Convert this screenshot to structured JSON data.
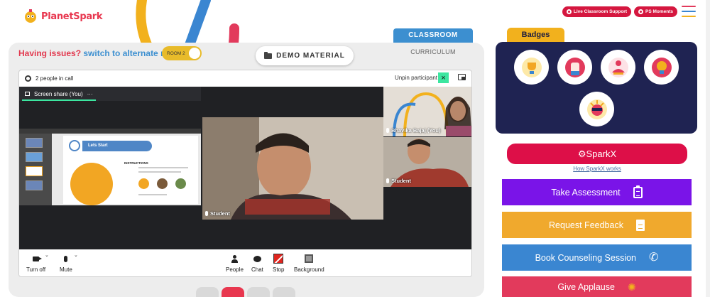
{
  "header": {
    "logo_text_a": "Planet",
    "logo_text_b": "Spark",
    "live_support": "Live Classroom Support",
    "ps_moments": "PS Moments"
  },
  "issues": {
    "question": "Having issues?",
    "switch": "switch to alternate room",
    "room_toggle": "ROOM 2"
  },
  "demo_material": "DEMO MATERIAL",
  "tabs": {
    "classroom": "CLASSROOM",
    "curriculum": "CURRICULUM"
  },
  "call": {
    "people_count": "2 people in call",
    "unpin": "Unpin participant",
    "screen_share_label": "Screen share (You)",
    "screen_share_more": "···",
    "slide_title": "Lets Start",
    "slide_instructions": "INSTRUCTIONS",
    "tiles": {
      "main": "Student",
      "self": "Bhavika Bajaj (You)",
      "second": "Student"
    },
    "controls": {
      "turn_off": "Turn off",
      "mute": "Mute",
      "people": "People",
      "chat": "Chat",
      "stop": "Stop",
      "background": "Background"
    }
  },
  "badges": {
    "title": "Badges",
    "items": [
      "trophy-badge",
      "fist-badge",
      "meditation-badge",
      "idea-badge",
      "geek-badge"
    ]
  },
  "sparkx": {
    "label": "⚙SparkX",
    "how": "How SparkX works"
  },
  "actions": [
    {
      "label": "Take Assessment",
      "color": "#7a14e8",
      "icon": "clipboard-icon"
    },
    {
      "label": "Request Feedback",
      "color": "#f0a92d",
      "icon": "document-icon"
    },
    {
      "label": "Book Counseling Session",
      "color": "#3a86d1",
      "icon": "phone-icon"
    },
    {
      "label": "Give Applause",
      "color": "#e23a5c",
      "icon": "clap-icon"
    }
  ]
}
